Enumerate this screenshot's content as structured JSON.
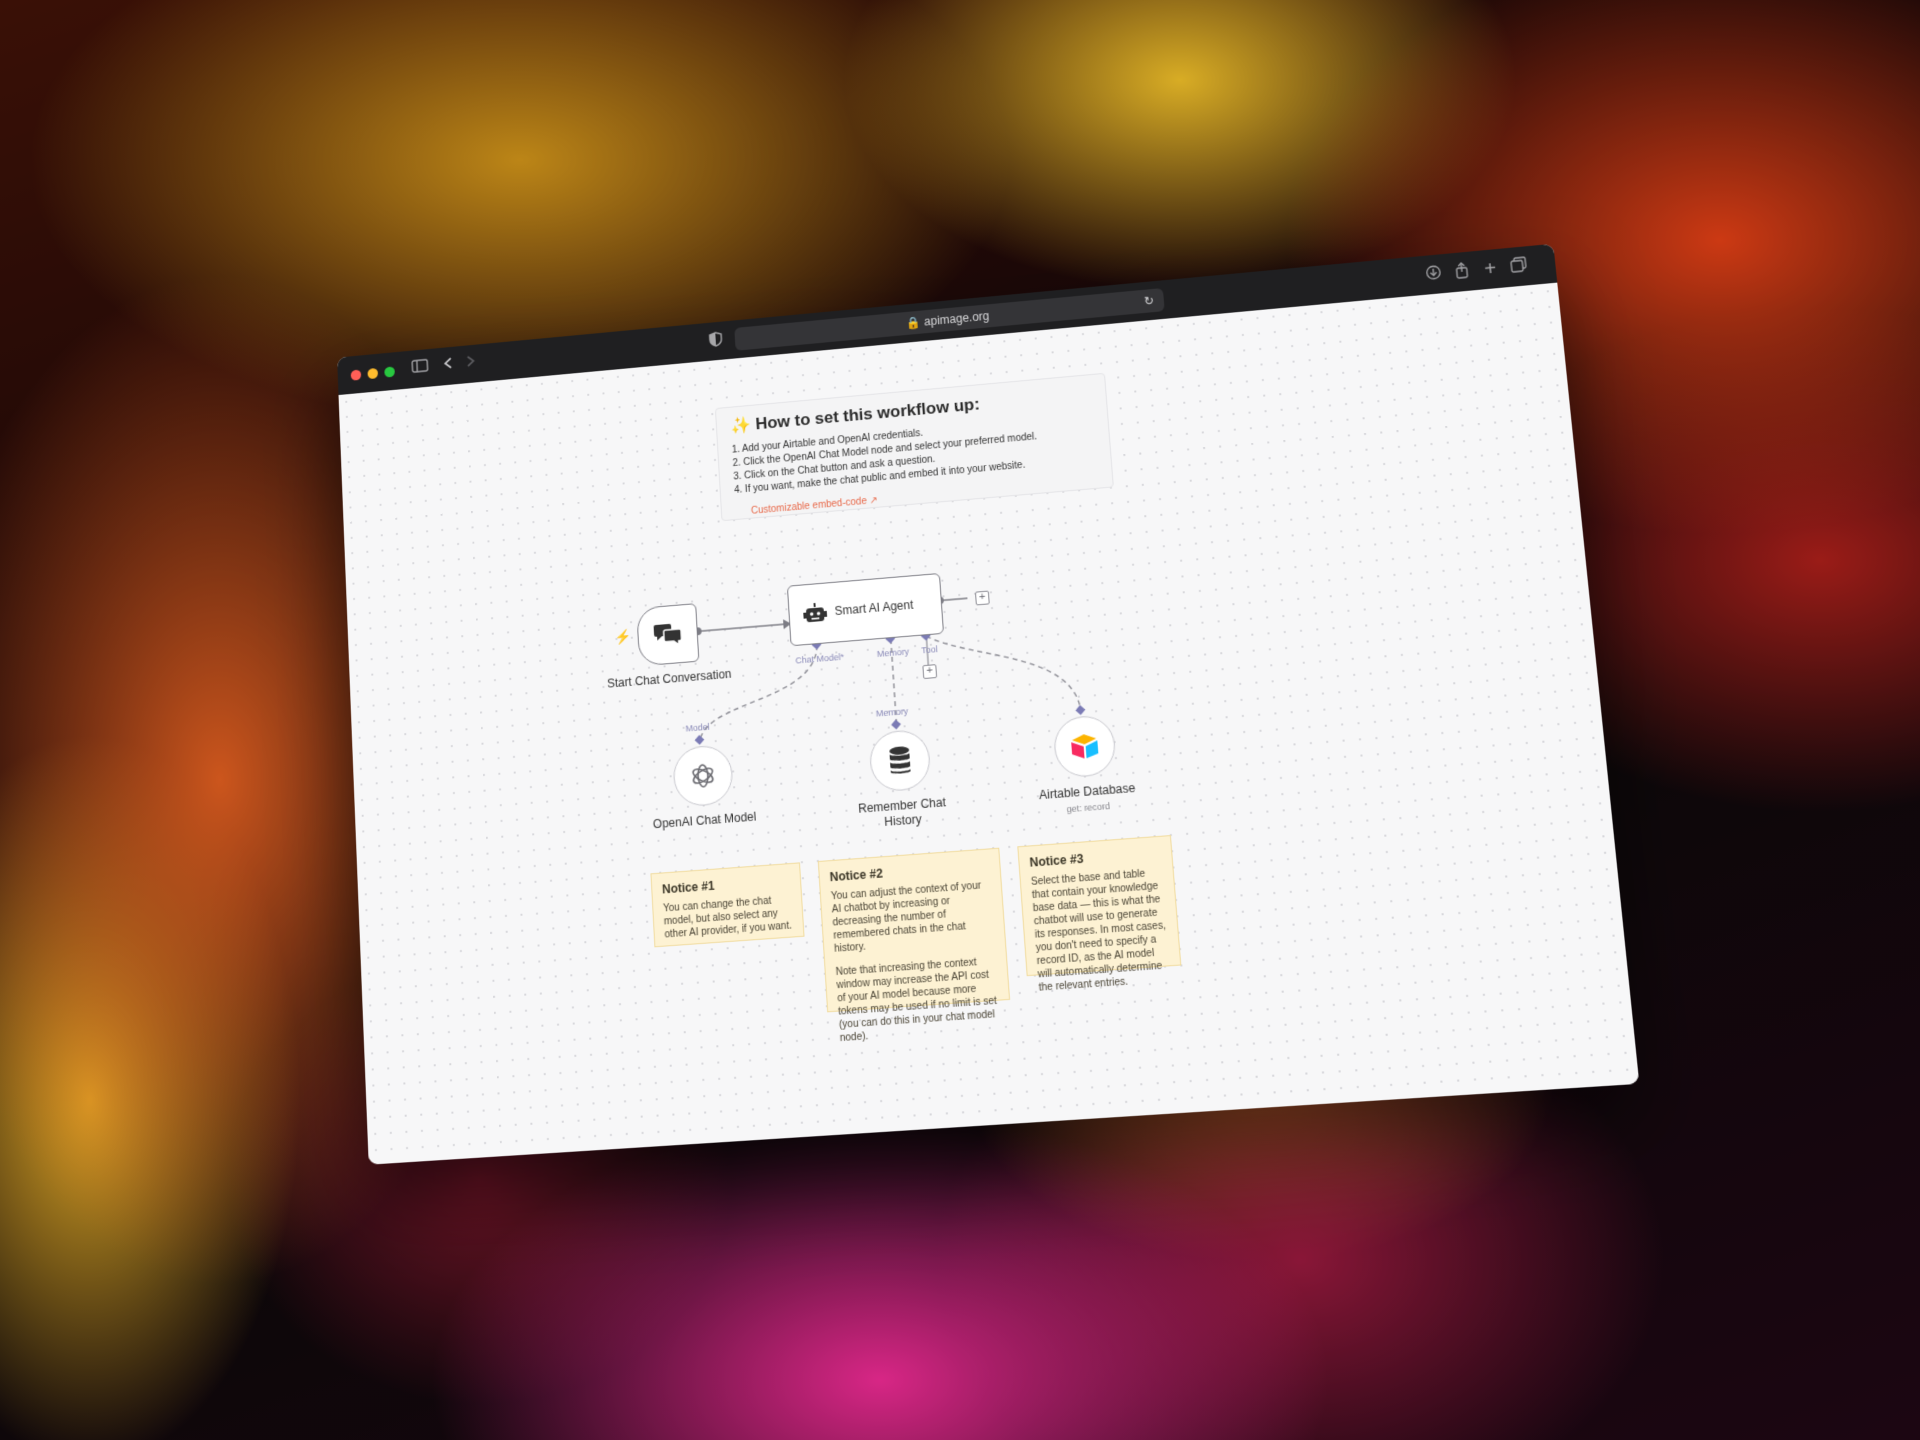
{
  "browser": {
    "url": "apimage.org"
  },
  "instructions": {
    "emoji": "✨",
    "title": "How to set this workflow up:",
    "steps": [
      "1. Add your Airtable and OpenAI credentials.",
      "2. Click the OpenAI Chat Model node and select your preferred model.",
      "3. Click on the Chat button and ask a question.",
      "4. If you want, make the chat public and embed it into your website."
    ],
    "link_label": "Customizable embed-code ↗"
  },
  "nodes": {
    "trigger": {
      "label": "Start Chat Conversation"
    },
    "agent": {
      "label": "Smart AI Agent",
      "ports": {
        "chat_model": "Chat Model*",
        "memory": "Memory",
        "tool": "Tool"
      }
    },
    "openai": {
      "label": "OpenAI Chat Model",
      "port": "Model"
    },
    "memory": {
      "label_line1": "Remember Chat",
      "label_line2": "History",
      "port": "Memory"
    },
    "airtable": {
      "label": "Airtable Database",
      "sublabel": "get: record"
    }
  },
  "notes": [
    {
      "title": "Notice #1",
      "body": "You can change the chat model, but also select any other AI provider, if you want."
    },
    {
      "title": "Notice #2",
      "body": "You can adjust the context of your AI chatbot by increasing or decreasing the number of remembered chats in the chat history.",
      "body2": "Note that increasing the context window may increase the API cost of your AI model because more tokens may be used if no limit is set (you can do this in your chat model node)."
    },
    {
      "title": "Notice #3",
      "body": "Select the base and table that contain your knowledge base data — this is what the chatbot will use to generate its responses. In most cases, you don't need to specify a record ID, as the AI model will automatically determine the relevant entries."
    }
  ],
  "colors": {
    "accent_link": "#e8694a",
    "note_bg": "#fdf2d3",
    "port_purple": "#7b7bb5",
    "traffic_red": "#ff5f57",
    "traffic_yellow": "#febc2e",
    "traffic_green": "#28c840"
  }
}
